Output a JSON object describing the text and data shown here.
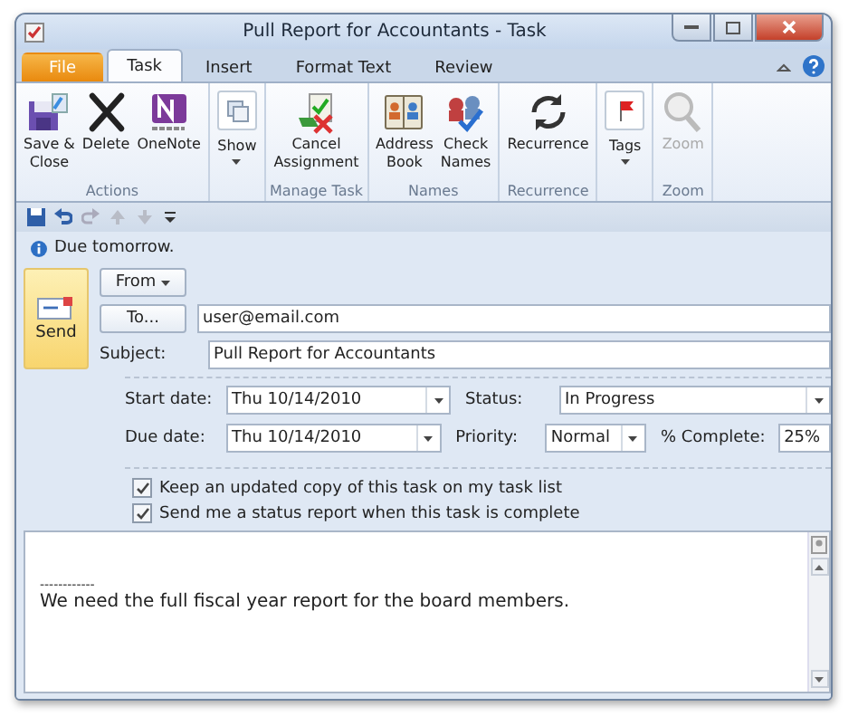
{
  "window": {
    "title": "Pull Report for Accountants  -  Task"
  },
  "tabs": [
    {
      "label": "File",
      "kind": "file",
      "selected": false
    },
    {
      "label": "Task",
      "kind": "tab",
      "selected": true
    },
    {
      "label": "Insert",
      "kind": "tab",
      "selected": false
    },
    {
      "label": "Format Text",
      "kind": "tab",
      "selected": false
    },
    {
      "label": "Review",
      "kind": "tab",
      "selected": false
    }
  ],
  "ribbon": {
    "groups": [
      {
        "label": "Actions",
        "buttons": [
          {
            "label": "Save &\nClose",
            "kind": "save",
            "dropdown": false,
            "disabled": false
          },
          {
            "label": "Delete",
            "kind": "delete",
            "dropdown": false,
            "disabled": false
          },
          {
            "label": "OneNote",
            "kind": "onenote",
            "dropdown": false,
            "disabled": false
          }
        ]
      },
      {
        "buttons": [
          {
            "label": "Show",
            "kind": "show",
            "dropdown": true,
            "disabled": false
          }
        ]
      },
      {
        "label": "Manage Task",
        "buttons": [
          {
            "label": "Cancel\nAssignment",
            "kind": "cancel",
            "dropdown": false,
            "disabled": false
          }
        ]
      },
      {
        "label": "Names",
        "buttons": [
          {
            "label": "Address\nBook",
            "kind": "address",
            "dropdown": false,
            "disabled": false
          },
          {
            "label": "Check\nNames",
            "kind": "check",
            "dropdown": false,
            "disabled": false
          }
        ]
      },
      {
        "label": "Recurrence",
        "buttons": [
          {
            "label": "Recurrence",
            "kind": "recurrence",
            "dropdown": false,
            "disabled": false
          }
        ]
      },
      {
        "buttons": [
          {
            "label": "Tags",
            "kind": "tags",
            "dropdown": true,
            "disabled": false
          }
        ]
      },
      {
        "label": "Zoom",
        "buttons": [
          {
            "label": "Zoom",
            "kind": "zoom",
            "dropdown": false,
            "disabled": true
          }
        ]
      }
    ]
  },
  "info": "Due tomorrow.",
  "send": {
    "label": "Send",
    "hovered": true
  },
  "from": {
    "label": "From"
  },
  "to": {
    "label": "To...",
    "value": "user@email.com"
  },
  "subject": {
    "label": "Subject:",
    "value": "Pull Report for Accountants"
  },
  "start_date": {
    "label": "Start date:",
    "value": "Thu 10/14/2010"
  },
  "status": {
    "label": "Status:",
    "value": "In Progress"
  },
  "due_date": {
    "label": "Due date:",
    "value": "Thu 10/14/2010"
  },
  "priority": {
    "label": "Priority:",
    "value": "Normal"
  },
  "complete": {
    "label": "% Complete:",
    "value": "25%"
  },
  "options": [
    {
      "label": "Keep an updated copy of this task on my task list",
      "checked": true
    },
    {
      "label": "Send me a status report when this task is complete",
      "checked": true
    }
  ],
  "message": {
    "separator": "------------",
    "text": "We need the full fiscal year report for the board members."
  }
}
